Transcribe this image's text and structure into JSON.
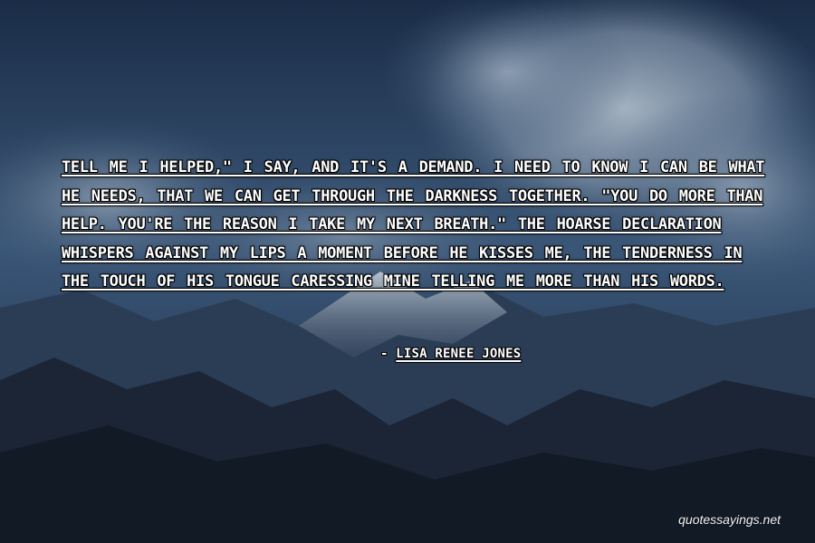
{
  "quote": {
    "text": "Tell me I helped,\" I say, and it's a demand. I need to know I can be what he needs, that we can get through the darkness together. \"You do more than help. You're the reason I take my next breath.\" The hoarse declaration whispers against my lips a moment before he kisses me, the tenderness in the touch of his tongue caressing mine telling me more than his words."
  },
  "author": {
    "dash": "-",
    "name": "Lisa Renee Jones"
  },
  "watermark": {
    "text": "quotessayings.net"
  },
  "colors": {
    "sky_top": "#1a2c46",
    "sky_mid": "#3a5677",
    "cloud": "#8a9bae",
    "mountain_far": "#2b3d55",
    "mountain_near": "#1b2536",
    "text": "#ffffff"
  }
}
